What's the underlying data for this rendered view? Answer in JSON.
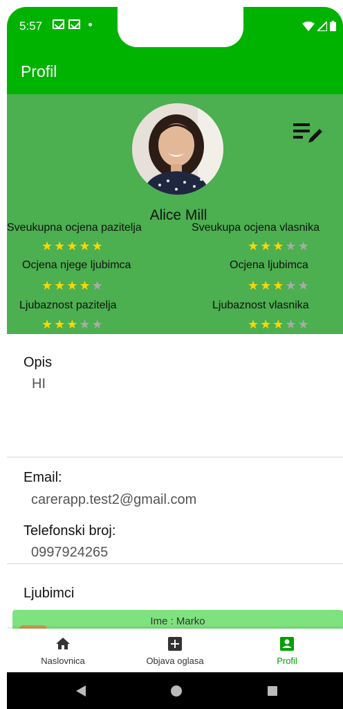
{
  "status_bar": {
    "time": "5:57",
    "icons_left": [
      "gmail-icon",
      "gmail-icon",
      "notification-dot"
    ],
    "icons_right": [
      "wifi-icon",
      "signal-icon",
      "battery-icon"
    ]
  },
  "app_bar": {
    "title": "Profil"
  },
  "profile": {
    "name": "Alice Mill",
    "edit_icon": "edit-list-icon",
    "ratings": [
      {
        "label": "Sveukupna ocjena pazitelja",
        "stars": 5
      },
      {
        "label": "Sveukupa ocjena vlasnika",
        "stars": 3
      },
      {
        "label": "Ocjena njege ljubimca",
        "stars": 4
      },
      {
        "label": "Ocjena ljubimca",
        "stars": 3
      },
      {
        "label": "Ljubaznost pazitelja",
        "stars": 3
      },
      {
        "label": "Ljubaznost vlasnika",
        "stars": 3
      }
    ],
    "max_stars": 5
  },
  "opis": {
    "title": "Opis",
    "value": "HI"
  },
  "email": {
    "title": "Email:",
    "value": "carerapp.test2@gmail.com"
  },
  "phone": {
    "title": "Telefonski broj:",
    "value": "0997924265"
  },
  "pets": {
    "title": "Ljubimci",
    "card_text": "Ime : Marko"
  },
  "bottom_nav": {
    "items": [
      {
        "label": "Naslovnica",
        "icon": "home-icon",
        "active": false
      },
      {
        "label": "Objava oglasa",
        "icon": "add-box-icon",
        "active": false
      },
      {
        "label": "Profil",
        "icon": "account-box-icon",
        "active": true
      }
    ]
  },
  "colors": {
    "app_bar": "#00b300",
    "header_bg": "#4caf50",
    "star_on": "#ffd600",
    "star_off": "#aaaaaa",
    "pet_card": "#7ee27e",
    "nav_active": "#00a000"
  }
}
